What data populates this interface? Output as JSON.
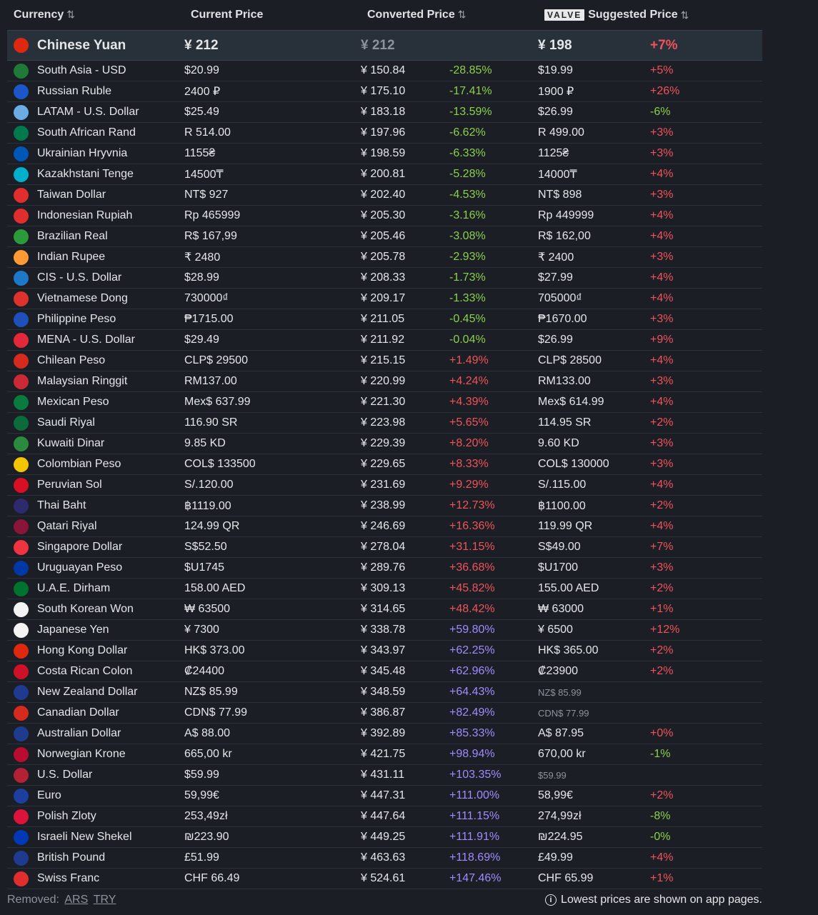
{
  "header": {
    "currency": "Currency",
    "current_price": "Current Price",
    "converted_price": "Converted Price",
    "valve_badge": "VALVE",
    "suggested_price": "Suggested Price",
    "sort_glyph": "⇅"
  },
  "base": {
    "name": "Chinese Yuan",
    "current": "¥ 212",
    "converted": "¥ 212",
    "suggested": "¥ 198",
    "suggested_pct": "+7%",
    "flag_color": "#de2910"
  },
  "rows": [
    {
      "name": "South Asia - USD",
      "current": "$20.99",
      "converted": "¥ 150.84",
      "pct": "-28.85%",
      "pct_cls": "g",
      "suggested": "$19.99",
      "spct": "+5%",
      "spct_cls": "r",
      "flag": "#1f7a3a"
    },
    {
      "name": "Russian Ruble",
      "current": "2400 ₽",
      "converted": "¥ 175.10",
      "pct": "-17.41%",
      "pct_cls": "g",
      "suggested": "1900 ₽",
      "spct": "+26%",
      "spct_cls": "r",
      "flag": "#1c57c9"
    },
    {
      "name": "LATAM - U.S. Dollar",
      "current": "$25.49",
      "converted": "¥ 183.18",
      "pct": "-13.59%",
      "pct_cls": "g",
      "suggested": "$26.99",
      "spct": "-6%",
      "spct_cls": "g",
      "flag": "#6cace4"
    },
    {
      "name": "South African Rand",
      "current": "R 514.00",
      "converted": "¥ 197.96",
      "pct": "-6.62%",
      "pct_cls": "g",
      "suggested": "R 499.00",
      "spct": "+3%",
      "spct_cls": "r",
      "flag": "#007a4d"
    },
    {
      "name": "Ukrainian Hryvnia",
      "current": "1155₴",
      "converted": "¥ 198.59",
      "pct": "-6.33%",
      "pct_cls": "g",
      "suggested": "1125₴",
      "spct": "+3%",
      "spct_cls": "r",
      "flag": "#0057b7"
    },
    {
      "name": "Kazakhstani Tenge",
      "current": "14500₸",
      "converted": "¥ 200.81",
      "pct": "-5.28%",
      "pct_cls": "g",
      "suggested": "14000₸",
      "spct": "+4%",
      "spct_cls": "r",
      "flag": "#00afca"
    },
    {
      "name": "Taiwan Dollar",
      "current": "NT$ 927",
      "converted": "¥ 202.40",
      "pct": "-4.53%",
      "pct_cls": "g",
      "suggested": "NT$ 898",
      "spct": "+3%",
      "spct_cls": "r",
      "flag": "#e02d2d"
    },
    {
      "name": "Indonesian Rupiah",
      "current": "Rp 465999",
      "converted": "¥ 205.30",
      "pct": "-3.16%",
      "pct_cls": "g",
      "suggested": "Rp 449999",
      "spct": "+4%",
      "spct_cls": "r",
      "flag": "#e02d2d"
    },
    {
      "name": "Brazilian Real",
      "current": "R$ 167,99",
      "converted": "¥ 205.46",
      "pct": "-3.08%",
      "pct_cls": "g",
      "suggested": "R$ 162,00",
      "spct": "+4%",
      "spct_cls": "r",
      "flag": "#2b9a3a"
    },
    {
      "name": "Indian Rupee",
      "current": "₹ 2480",
      "converted": "¥ 205.78",
      "pct": "-2.93%",
      "pct_cls": "g",
      "suggested": "₹ 2400",
      "spct": "+3%",
      "spct_cls": "r",
      "flag": "#ff9933"
    },
    {
      "name": "CIS - U.S. Dollar",
      "current": "$28.99",
      "converted": "¥ 208.33",
      "pct": "-1.73%",
      "pct_cls": "g",
      "suggested": "$27.99",
      "spct": "+4%",
      "spct_cls": "r",
      "flag": "#1e78c8"
    },
    {
      "name": "Vietnamese Dong",
      "current": "730000₫",
      "converted": "¥ 209.17",
      "pct": "-1.33%",
      "pct_cls": "g",
      "suggested": "705000₫",
      "spct": "+4%",
      "spct_cls": "r",
      "flag": "#e0322d"
    },
    {
      "name": "Philippine Peso",
      "current": "₱1715.00",
      "converted": "¥ 211.05",
      "pct": "-0.45%",
      "pct_cls": "g",
      "suggested": "₱1670.00",
      "spct": "+3%",
      "spct_cls": "r",
      "flag": "#1f4fb8"
    },
    {
      "name": "MENA - U.S. Dollar",
      "current": "$29.49",
      "converted": "¥ 211.92",
      "pct": "-0.04%",
      "pct_cls": "g",
      "suggested": "$26.99",
      "spct": "+9%",
      "spct_cls": "r",
      "flag": "#e3283a"
    },
    {
      "name": "Chilean Peso",
      "current": "CLP$ 29500",
      "converted": "¥ 215.15",
      "pct": "+1.49%",
      "pct_cls": "r",
      "suggested": "CLP$ 28500",
      "spct": "+4%",
      "spct_cls": "r",
      "flag": "#d52b1e"
    },
    {
      "name": "Malaysian Ringgit",
      "current": "RM137.00",
      "converted": "¥ 220.99",
      "pct": "+4.24%",
      "pct_cls": "r",
      "suggested": "RM133.00",
      "spct": "+3%",
      "spct_cls": "r",
      "flag": "#cc2936"
    },
    {
      "name": "Mexican Peso",
      "current": "Mex$ 637.99",
      "converted": "¥ 221.30",
      "pct": "+4.39%",
      "pct_cls": "r",
      "suggested": "Mex$ 614.99",
      "spct": "+4%",
      "spct_cls": "r",
      "flag": "#0a7a3f"
    },
    {
      "name": "Saudi Riyal",
      "current": "116.90 SR",
      "converted": "¥ 223.98",
      "pct": "+5.65%",
      "pct_cls": "r",
      "suggested": "114.95 SR",
      "spct": "+2%",
      "spct_cls": "r",
      "flag": "#0b6b3a"
    },
    {
      "name": "Kuwaiti Dinar",
      "current": "9.85 KD",
      "converted": "¥ 229.39",
      "pct": "+8.20%",
      "pct_cls": "r",
      "suggested": "9.60 KD",
      "spct": "+3%",
      "spct_cls": "r",
      "flag": "#2b8a3e"
    },
    {
      "name": "Colombian Peso",
      "current": "COL$ 133500",
      "converted": "¥ 229.65",
      "pct": "+8.33%",
      "pct_cls": "r",
      "suggested": "COL$ 130000",
      "spct": "+3%",
      "spct_cls": "r",
      "flag": "#f4c400"
    },
    {
      "name": "Peruvian Sol",
      "current": "S/.120.00",
      "converted": "¥ 231.69",
      "pct": "+9.29%",
      "pct_cls": "r",
      "suggested": "S/.115.00",
      "spct": "+4%",
      "spct_cls": "r",
      "flag": "#d91023"
    },
    {
      "name": "Thai Baht",
      "current": "฿1119.00",
      "converted": "¥ 238.99",
      "pct": "+12.73%",
      "pct_cls": "r",
      "suggested": "฿1100.00",
      "spct": "+2%",
      "spct_cls": "r",
      "flag": "#2d2a6e"
    },
    {
      "name": "Qatari Riyal",
      "current": "124.99 QR",
      "converted": "¥ 246.69",
      "pct": "+16.36%",
      "pct_cls": "r",
      "suggested": "119.99 QR",
      "spct": "+4%",
      "spct_cls": "r",
      "flag": "#8a1538"
    },
    {
      "name": "Singapore Dollar",
      "current": "S$52.50",
      "converted": "¥ 278.04",
      "pct": "+31.15%",
      "pct_cls": "r",
      "suggested": "S$49.00",
      "spct": "+7%",
      "spct_cls": "r",
      "flag": "#ef3340"
    },
    {
      "name": "Uruguayan Peso",
      "current": "$U1745",
      "converted": "¥ 289.76",
      "pct": "+36.68%",
      "pct_cls": "r",
      "suggested": "$U1700",
      "spct": "+3%",
      "spct_cls": "r",
      "flag": "#0038a8"
    },
    {
      "name": "U.A.E. Dirham",
      "current": "158.00 AED",
      "converted": "¥ 309.13",
      "pct": "+45.82%",
      "pct_cls": "r",
      "suggested": "155.00 AED",
      "spct": "+2%",
      "spct_cls": "r",
      "flag": "#00732f"
    },
    {
      "name": "South Korean Won",
      "current": "₩ 63500",
      "converted": "¥ 314.65",
      "pct": "+48.42%",
      "pct_cls": "r",
      "suggested": "₩ 63000",
      "spct": "+1%",
      "spct_cls": "r",
      "flag": "#f3f3f3"
    },
    {
      "name": "Japanese Yen",
      "current": "¥ 7300",
      "converted": "¥ 338.78",
      "pct": "+59.80%",
      "pct_cls": "p",
      "suggested": "¥ 6500",
      "spct": "+12%",
      "spct_cls": "r",
      "flag": "#f3f3f3"
    },
    {
      "name": "Hong Kong Dollar",
      "current": "HK$ 373.00",
      "converted": "¥ 343.97",
      "pct": "+62.25%",
      "pct_cls": "p",
      "suggested": "HK$ 365.00",
      "spct": "+2%",
      "spct_cls": "r",
      "flag": "#de2910"
    },
    {
      "name": "Costa Rican Colon",
      "current": "₡24400",
      "converted": "¥ 345.48",
      "pct": "+62.96%",
      "pct_cls": "p",
      "suggested": "₡23900",
      "spct": "+2%",
      "spct_cls": "r",
      "flag": "#ce1126"
    },
    {
      "name": "New Zealand Dollar",
      "current": "NZ$ 85.99",
      "converted": "¥ 348.59",
      "pct": "+64.43%",
      "pct_cls": "p",
      "suggested": "NZ$ 85.99",
      "sug_muted": true,
      "spct": "",
      "spct_cls": "",
      "flag": "#1f3b8f"
    },
    {
      "name": "Canadian Dollar",
      "current": "CDN$ 77.99",
      "converted": "¥ 386.87",
      "pct": "+82.49%",
      "pct_cls": "p",
      "suggested": "CDN$ 77.99",
      "sug_muted": true,
      "spct": "",
      "spct_cls": "",
      "flag": "#d52b1e"
    },
    {
      "name": "Australian Dollar",
      "current": "A$ 88.00",
      "converted": "¥ 392.89",
      "pct": "+85.33%",
      "pct_cls": "p",
      "suggested": "A$ 87.95",
      "spct": "+0%",
      "spct_cls": "r",
      "flag": "#1f3b8f"
    },
    {
      "name": "Norwegian Krone",
      "current": "665,00 kr",
      "converted": "¥ 421.75",
      "pct": "+98.94%",
      "pct_cls": "p",
      "suggested": "670,00 kr",
      "spct": "-1%",
      "spct_cls": "g",
      "flag": "#ba0c2f"
    },
    {
      "name": "U.S. Dollar",
      "current": "$59.99",
      "converted": "¥ 431.11",
      "pct": "+103.35%",
      "pct_cls": "p",
      "suggested": "$59.99",
      "sug_muted": true,
      "spct": "",
      "spct_cls": "",
      "flag": "#b22234"
    },
    {
      "name": "Euro",
      "current": "59,99€",
      "converted": "¥ 447.31",
      "pct": "+111.00%",
      "pct_cls": "p",
      "suggested": "58,99€",
      "spct": "+2%",
      "spct_cls": "r",
      "flag": "#1c3fa0"
    },
    {
      "name": "Polish Zloty",
      "current": "253,49zł",
      "converted": "¥ 447.64",
      "pct": "+111.15%",
      "pct_cls": "p",
      "suggested": "274,99zł",
      "spct": "-8%",
      "spct_cls": "g",
      "flag": "#dc143c"
    },
    {
      "name": "Israeli New Shekel",
      "current": "₪223.90",
      "converted": "¥ 449.25",
      "pct": "+111.91%",
      "pct_cls": "p",
      "suggested": "₪224.95",
      "spct": "-0%",
      "spct_cls": "g",
      "flag": "#0038b8"
    },
    {
      "name": "British Pound",
      "current": "£51.99",
      "converted": "¥ 463.63",
      "pct": "+118.69%",
      "pct_cls": "p",
      "suggested": "£49.99",
      "spct": "+4%",
      "spct_cls": "r",
      "flag": "#1f3b8f"
    },
    {
      "name": "Swiss Franc",
      "current": "CHF 66.49",
      "converted": "¥ 524.61",
      "pct": "+147.46%",
      "pct_cls": "p",
      "suggested": "CHF 65.99",
      "spct": "+1%",
      "spct_cls": "r",
      "flag": "#e02d2d"
    }
  ],
  "footer": {
    "removed_label": "Removed:",
    "removed_links": [
      "ARS",
      "TRY"
    ],
    "note": "Lowest prices are shown on app pages.",
    "info_icon": "i"
  }
}
